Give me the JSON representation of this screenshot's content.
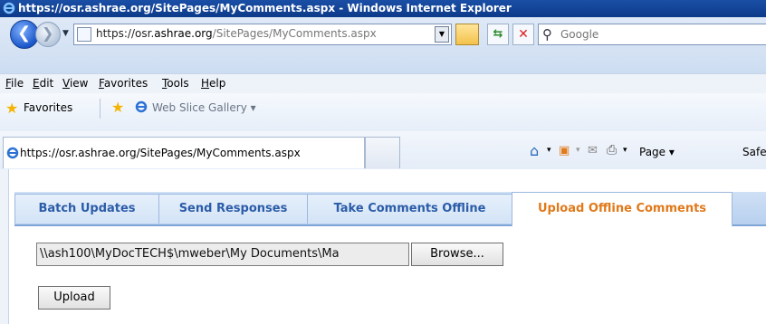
{
  "window": {
    "title": "https://osr.ashrae.org/SitePages/MyComments.aspx - Windows Internet Explorer"
  },
  "addressbar": {
    "url_domain_prefix": "https://osr.",
    "url_domain": "ashrae.org",
    "url_path": "/SitePages/MyComments.aspx",
    "search_placeholder": "Google"
  },
  "menubar": {
    "items": [
      "File",
      "Edit",
      "View",
      "Favorites",
      "Tools",
      "Help"
    ]
  },
  "favorites": {
    "label": "Favorites",
    "web_slice": "Web Slice Gallery ▾"
  },
  "browser_tab": {
    "title": "https://osr.ashrae.org/SitePages/MyComments.aspx"
  },
  "commandbar": {
    "page": "Page ▾",
    "safety": "Safe"
  },
  "page": {
    "tabs": [
      {
        "label": "Batch Updates"
      },
      {
        "label": "Send Responses"
      },
      {
        "label": "Take Comments Offline"
      },
      {
        "label": "Upload Offline Comments",
        "active": true
      }
    ],
    "file_path": "\\\\ash100\\MyDocTECH$\\mweber\\My Documents\\Ma",
    "browse_label": "Browse...",
    "upload_label": "Upload"
  },
  "colors": {
    "active_tab_text": "#e0791a",
    "tab_text": "#2b5ca8",
    "titlebar": "#1a4fa6"
  }
}
